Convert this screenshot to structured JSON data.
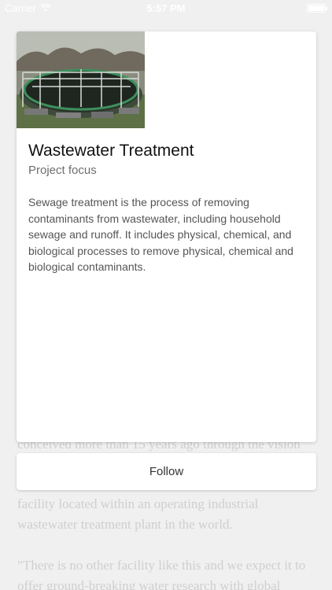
{
  "status_bar": {
    "carrier": "Carrier",
    "time": "5:57 PM"
  },
  "background_article": {
    "line_1": "conceived more than 15 years ago through the vision",
    "line_2": "facility located within an operating industrial wastewater treatment plant in the world.",
    "line_3": "\"There is no other facility like this and we expect it to offer ground-breaking water research with global"
  },
  "card": {
    "image_alt": "wastewater treatment tank photo",
    "title": "Wastewater Treatment",
    "subtitle": "Project focus",
    "description": "Sewage treatment is the process of removing contaminants from wastewater, including household sewage and runoff. It includes physical, chemical, and biological processes to remove physical, chemical and biological contaminants."
  },
  "follow_button": {
    "label": "Follow"
  }
}
